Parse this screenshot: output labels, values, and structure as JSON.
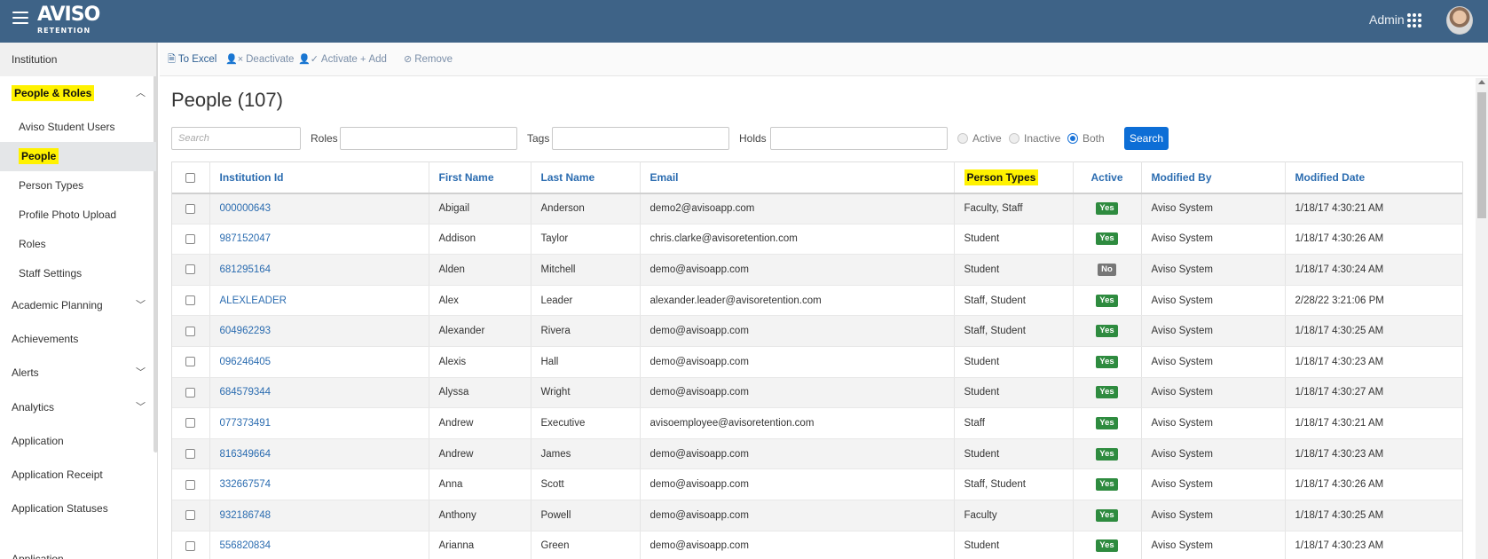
{
  "header": {
    "logo_top": "AVISO",
    "logo_bottom": "RETENTION",
    "user_label": "Admin"
  },
  "sidebar": {
    "items": [
      {
        "label": "Institution",
        "highlight": false
      },
      {
        "label": "People & Roles",
        "highlight": true,
        "chevron": "up"
      },
      {
        "label": "Aviso Student Users"
      },
      {
        "label": "People",
        "highlight": true
      },
      {
        "label": "Person Types"
      },
      {
        "label": "Profile Photo Upload"
      },
      {
        "label": "Roles"
      },
      {
        "label": "Staff Settings"
      },
      {
        "label": "Academic Planning",
        "chevron": "down"
      },
      {
        "label": "Achievements"
      },
      {
        "label": "Alerts",
        "chevron": "down"
      },
      {
        "label": "Analytics",
        "chevron": "down"
      },
      {
        "label": "Application"
      },
      {
        "label": "Application Receipt"
      },
      {
        "label": "Application Statuses"
      }
    ]
  },
  "toolbar": {
    "to_excel": "To Excel",
    "deactivate": "Deactivate",
    "activate": "Activate",
    "add": "Add",
    "remove": "Remove"
  },
  "page": {
    "title": "People (107)"
  },
  "filters": {
    "search_placeholder": "Search",
    "roles_label": "Roles",
    "tags_label": "Tags",
    "holds_label": "Holds",
    "radio_active": "Active",
    "radio_inactive": "Inactive",
    "radio_both": "Both",
    "selected_status": "Both",
    "search_button": "Search"
  },
  "table": {
    "columns": [
      "Institution Id",
      "First Name",
      "Last Name",
      "Email",
      "Person Types",
      "Active",
      "Modified By",
      "Modified Date"
    ],
    "rows": [
      {
        "id": "000000643",
        "first": "Abigail",
        "last": "Anderson",
        "email": "demo2@avisoapp.com",
        "types": "Faculty, Staff",
        "active": "Yes",
        "modified_by": "Aviso System",
        "modified_date": "1/18/17 4:30:21 AM"
      },
      {
        "id": "987152047",
        "first": "Addison",
        "last": "Taylor",
        "email": "chris.clarke@avisoretention.com",
        "types": "Student",
        "active": "Yes",
        "modified_by": "Aviso System",
        "modified_date": "1/18/17 4:30:26 AM"
      },
      {
        "id": "681295164",
        "first": "Alden",
        "last": "Mitchell",
        "email": "demo@avisoapp.com",
        "types": "Student",
        "active": "No",
        "modified_by": "Aviso System",
        "modified_date": "1/18/17 4:30:24 AM"
      },
      {
        "id": "ALEXLEADER",
        "first": "Alex",
        "last": "Leader",
        "email": "alexander.leader@avisoretention.com",
        "types": "Staff, Student",
        "active": "Yes",
        "modified_by": "Aviso System",
        "modified_date": "2/28/22 3:21:06 PM"
      },
      {
        "id": "604962293",
        "first": "Alexander",
        "last": "Rivera",
        "email": "demo@avisoapp.com",
        "types": "Staff, Student",
        "active": "Yes",
        "modified_by": "Aviso System",
        "modified_date": "1/18/17 4:30:25 AM"
      },
      {
        "id": "096246405",
        "first": "Alexis",
        "last": "Hall",
        "email": "demo@avisoapp.com",
        "types": "Student",
        "active": "Yes",
        "modified_by": "Aviso System",
        "modified_date": "1/18/17 4:30:23 AM"
      },
      {
        "id": "684579344",
        "first": "Alyssa",
        "last": "Wright",
        "email": "demo@avisoapp.com",
        "types": "Student",
        "active": "Yes",
        "modified_by": "Aviso System",
        "modified_date": "1/18/17 4:30:27 AM"
      },
      {
        "id": "077373491",
        "first": "Andrew",
        "last": "Executive",
        "email": "avisoemployee@avisoretention.com",
        "types": "Staff",
        "active": "Yes",
        "modified_by": "Aviso System",
        "modified_date": "1/18/17 4:30:21 AM"
      },
      {
        "id": "816349664",
        "first": "Andrew",
        "last": "James",
        "email": "demo@avisoapp.com",
        "types": "Student",
        "active": "Yes",
        "modified_by": "Aviso System",
        "modified_date": "1/18/17 4:30:23 AM"
      },
      {
        "id": "332667574",
        "first": "Anna",
        "last": "Scott",
        "email": "demo@avisoapp.com",
        "types": "Staff, Student",
        "active": "Yes",
        "modified_by": "Aviso System",
        "modified_date": "1/18/17 4:30:26 AM"
      },
      {
        "id": "932186748",
        "first": "Anthony",
        "last": "Powell",
        "email": "demo@avisoapp.com",
        "types": "Faculty",
        "active": "Yes",
        "modified_by": "Aviso System",
        "modified_date": "1/18/17 4:30:25 AM"
      },
      {
        "id": "556820834",
        "first": "Arianna",
        "last": "Green",
        "email": "demo@avisoapp.com",
        "types": "Student",
        "active": "Yes",
        "modified_by": "Aviso System",
        "modified_date": "1/18/17 4:30:23 AM"
      }
    ]
  },
  "colors": {
    "header_bg": "#3e6387",
    "link": "#2b6cb0",
    "highlight": "#fff200",
    "badge_yes": "#2e8b3f",
    "badge_no": "#777777",
    "search_button": "#0d6ed6"
  }
}
